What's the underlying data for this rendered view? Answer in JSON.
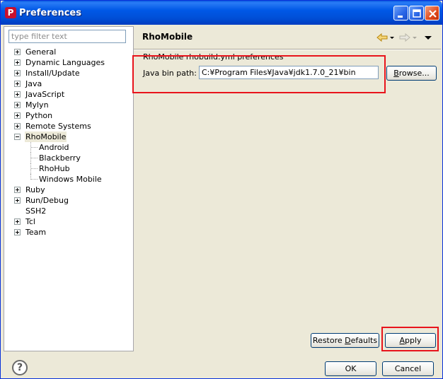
{
  "window": {
    "title": "Preferences",
    "app_icon_glyph": "P",
    "accent_color": "#0054e3",
    "highlight_color": "#e8141c"
  },
  "filter": {
    "placeholder": "type filter text"
  },
  "tree": {
    "items": [
      {
        "label": "General",
        "expander": "plus",
        "level": 0
      },
      {
        "label": "Dynamic Languages",
        "expander": "plus",
        "level": 0
      },
      {
        "label": "Install/Update",
        "expander": "plus",
        "level": 0
      },
      {
        "label": "Java",
        "expander": "plus",
        "level": 0
      },
      {
        "label": "JavaScript",
        "expander": "plus",
        "level": 0
      },
      {
        "label": "Mylyn",
        "expander": "plus",
        "level": 0
      },
      {
        "label": "Python",
        "expander": "plus",
        "level": 0
      },
      {
        "label": "Remote Systems",
        "expander": "plus",
        "level": 0
      },
      {
        "label": "RhoMobile",
        "expander": "minus",
        "level": 0,
        "selected": true
      },
      {
        "label": "Android",
        "expander": "none",
        "level": 1
      },
      {
        "label": "Blackberry",
        "expander": "none",
        "level": 1
      },
      {
        "label": "RhoHub",
        "expander": "none",
        "level": 1
      },
      {
        "label": "Windows Mobile",
        "expander": "none",
        "level": 1
      },
      {
        "label": "Ruby",
        "expander": "plus",
        "level": 0
      },
      {
        "label": "Run/Debug",
        "expander": "plus",
        "level": 0
      },
      {
        "label": "SSH2",
        "expander": "none",
        "level": 0
      },
      {
        "label": "Tcl",
        "expander": "plus",
        "level": 0
      },
      {
        "label": "Team",
        "expander": "plus",
        "level": 0
      }
    ]
  },
  "page": {
    "title": "RhoMobile",
    "section_label": "RhoMobile rhobuild.yml preferences",
    "java_bin_label_prefix": "",
    "java_bin_label_mnemonic": "J",
    "java_bin_label_rest": "ava bin path:",
    "java_bin_value": "C:¥Program Files¥Java¥jdk1.7.0_21¥bin",
    "browse_label": "Browse...",
    "browse_mnemonic": "B",
    "browse_rest": "rowse...",
    "restore_prefix": "Restore ",
    "restore_mnemonic": "D",
    "restore_rest": "efaults",
    "apply_mnemonic": "A",
    "apply_rest": "pply",
    "nav_icons": [
      "back-arrow-icon",
      "back-dropdown-icon",
      "forward-arrow-icon",
      "forward-dropdown-icon",
      "view-menu-icon"
    ]
  },
  "footer": {
    "help_glyph": "?",
    "ok_label": "OK",
    "cancel_label": "Cancel"
  }
}
